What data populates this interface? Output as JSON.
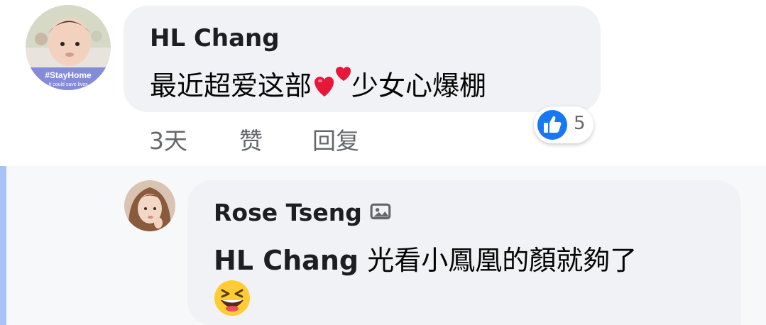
{
  "comment": {
    "author": "HL Chang",
    "avatar_text": "#StayHome",
    "avatar_subtext": "It could save lives",
    "text_before": "最近超爱这部",
    "text_after": "少女心爆棚",
    "time": "3天",
    "like_label": "赞",
    "reply_label": "回复",
    "reaction_icon": "like-icon",
    "reaction_count": "5"
  },
  "reply": {
    "author": "Rose Tseng",
    "badge_icon": "image-badge-icon",
    "mention": "HL Chang",
    "text": "光看小鳳凰的顏就夠了",
    "emoji": "grinning-squinting-face-emoji"
  },
  "colors": {
    "bubble": "#f0f2f5",
    "like_blue": "#1877f2",
    "reply_indicator": "#a9c2f5",
    "meta_text": "#65676b"
  }
}
